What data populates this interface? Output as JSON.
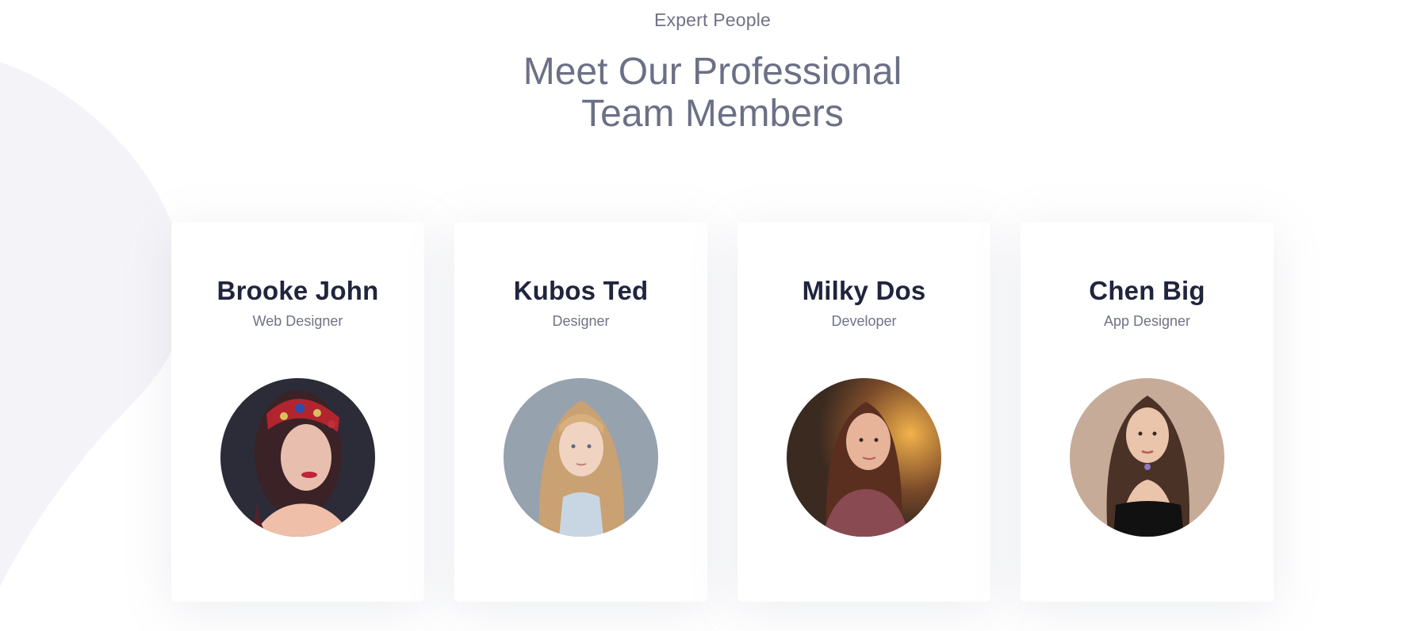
{
  "section": {
    "eyebrow": "Expert People",
    "title_line1": "Meet Our Professional",
    "title_line2": "Team Members"
  },
  "colors": {
    "background": "#ffffff",
    "blob": "#f4f4f8",
    "heading": "#20243d",
    "muted": "#6f7386"
  },
  "team": [
    {
      "name": "Brooke John",
      "role": "Web Designer",
      "photo": "woman-with-jeweled-headpiece-photo"
    },
    {
      "name": "Kubos Ted",
      "role": "Designer",
      "photo": "blonde-girl-photo"
    },
    {
      "name": "Milky Dos",
      "role": "Developer",
      "photo": "brunette-woman-photo"
    },
    {
      "name": "Chen Big",
      "role": "App Designer",
      "photo": "woman-with-wavy-hair-photo"
    }
  ]
}
